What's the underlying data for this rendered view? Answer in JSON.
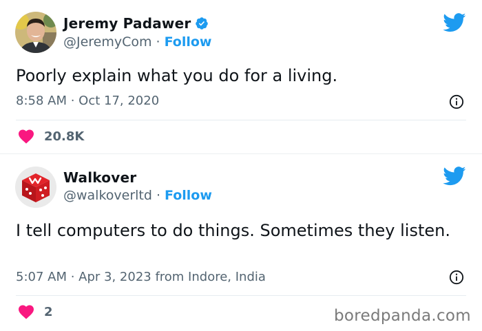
{
  "colors": {
    "twitter_blue": "#1d9bf0",
    "heart_pink": "#f91880",
    "muted_text": "#536471",
    "main_text": "#0f1419"
  },
  "tweets": [
    {
      "author_name": "Jeremy Padawer",
      "verified": true,
      "handle": "@JeremyCom",
      "separator": "·",
      "follow_label": "Follow",
      "text": "Poorly explain what you do for a living.",
      "meta": "8:58 AM · Oct 17, 2020",
      "likes": "20.8K",
      "avatar_icon": "person-photo-avatar",
      "logo_icon": "twitter-bird-icon"
    },
    {
      "author_name": "Walkover",
      "verified": false,
      "handle": "@walkoverltd",
      "separator": "·",
      "follow_label": "Follow",
      "text": "I tell computers to do things. Sometimes they listen.",
      "meta": "5:07 AM · Apr 3, 2023 from Indore, India",
      "likes": "2",
      "avatar_icon": "red-dice-logo-avatar",
      "logo_icon": "twitter-bird-icon"
    }
  ],
  "watermark": "boredpanda.com"
}
